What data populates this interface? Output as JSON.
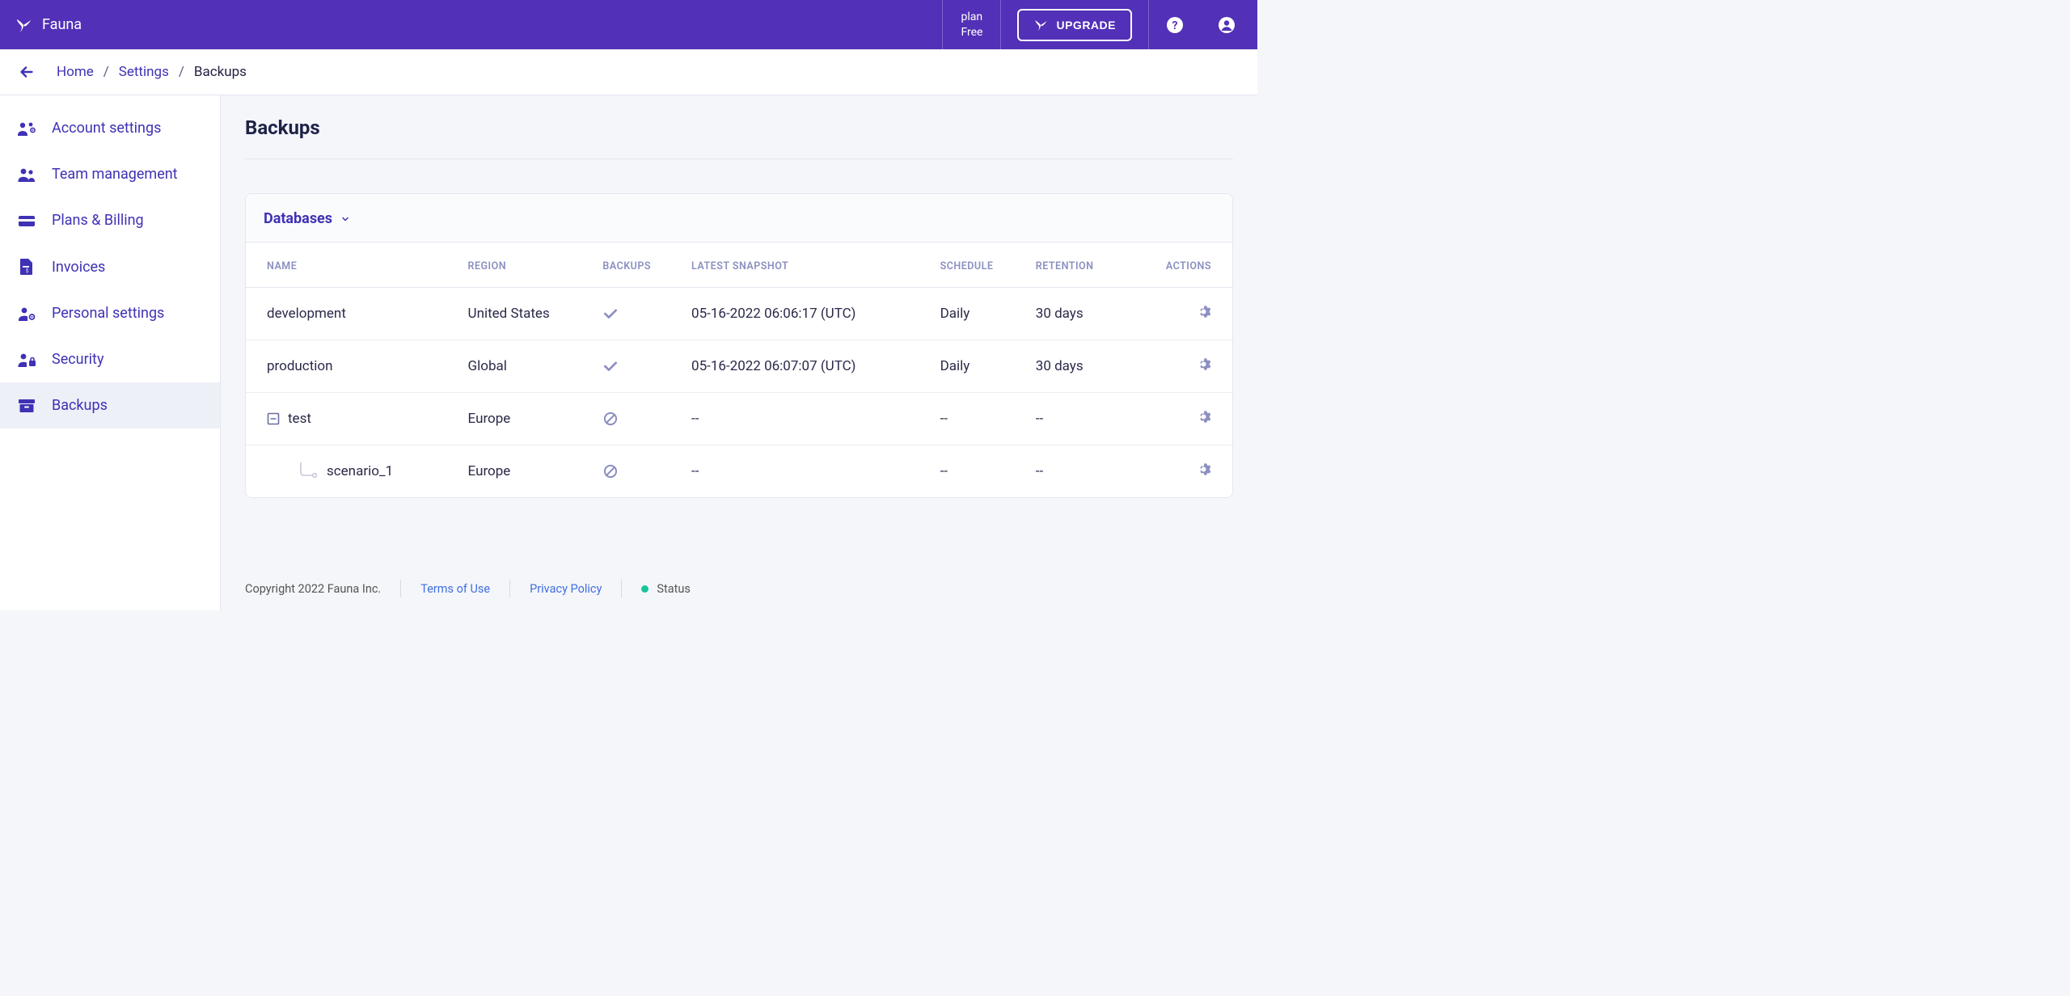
{
  "header": {
    "brand": "Fauna",
    "plan_label": "plan",
    "plan_value": "Free",
    "upgrade_label": "UPGRADE"
  },
  "breadcrumb": {
    "items": [
      "Home",
      "Settings",
      "Backups"
    ]
  },
  "sidebar": {
    "items": [
      {
        "label": "Account settings",
        "icon": "users-cog"
      },
      {
        "label": "Team management",
        "icon": "users"
      },
      {
        "label": "Plans & Billing",
        "icon": "credit-card"
      },
      {
        "label": "Invoices",
        "icon": "file-invoice"
      },
      {
        "label": "Personal settings",
        "icon": "user-cog"
      },
      {
        "label": "Security",
        "icon": "user-lock"
      },
      {
        "label": "Backups",
        "icon": "archive",
        "active": true
      }
    ]
  },
  "page": {
    "title": "Backups"
  },
  "card": {
    "title": "Databases",
    "columns": [
      "NAME",
      "REGION",
      "BACKUPS",
      "LATEST SNAPSHOT",
      "SCHEDULE",
      "RETENTION",
      "ACTIONS"
    ],
    "rows": [
      {
        "name": "development",
        "region": "United States",
        "backups": "enabled",
        "latest": "05-16-2022 06:06:17 (UTC)",
        "schedule": "Daily",
        "retention": "30 days",
        "indent": 0,
        "tree": null
      },
      {
        "name": "production",
        "region": "Global",
        "backups": "enabled",
        "latest": "05-16-2022 06:07:07 (UTC)",
        "schedule": "Daily",
        "retention": "30 days",
        "indent": 0,
        "tree": null
      },
      {
        "name": "test",
        "region": "Europe",
        "backups": "disabled",
        "latest": "--",
        "schedule": "--",
        "retention": "--",
        "indent": 0,
        "tree": "collapse"
      },
      {
        "name": "scenario_1",
        "region": "Europe",
        "backups": "disabled",
        "latest": "--",
        "schedule": "--",
        "retention": "--",
        "indent": 1,
        "tree": "leaf"
      }
    ]
  },
  "footer": {
    "copyright": "Copyright 2022 Fauna Inc.",
    "terms": "Terms of Use",
    "privacy": "Privacy Policy",
    "status": "Status"
  }
}
